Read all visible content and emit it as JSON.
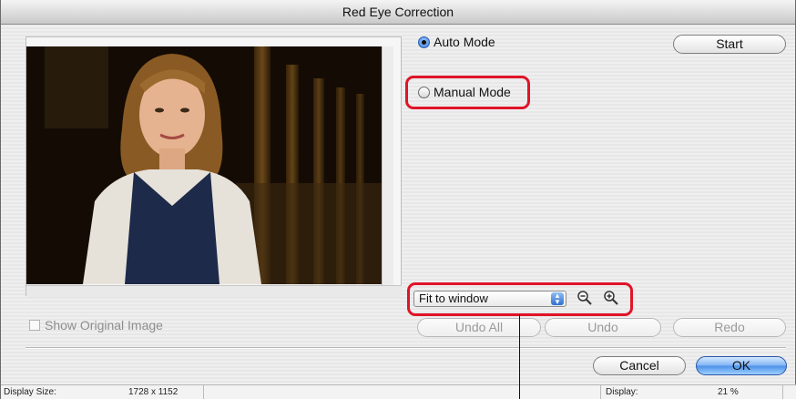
{
  "window": {
    "title": "Red Eye Correction"
  },
  "mode": {
    "auto_label": "Auto Mode",
    "manual_label": "Manual Mode",
    "selected": "auto"
  },
  "buttons": {
    "start": "Start",
    "undo_all": "Undo All",
    "undo": "Undo",
    "redo": "Redo",
    "cancel": "Cancel",
    "ok": "OK"
  },
  "zoom": {
    "selected": "Fit to window",
    "zoom_out_icon": "zoom-out-icon",
    "zoom_in_icon": "zoom-in-icon"
  },
  "checkbox": {
    "show_original": "Show Original Image",
    "checked": false
  },
  "status": {
    "display_size_label": "Display Size:",
    "display_size_value": "1728 x 1152",
    "display_label": "Display:",
    "display_value": "21 %"
  },
  "colors": {
    "highlight": "#e01428",
    "accent": "#4a90e8"
  }
}
